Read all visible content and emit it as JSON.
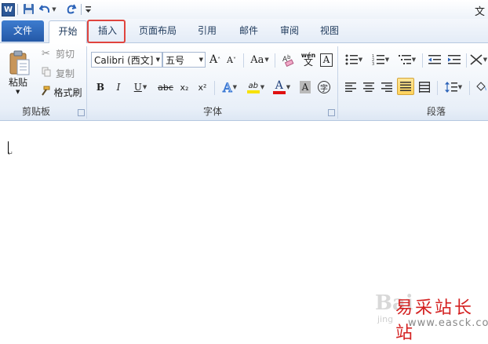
{
  "quick_access": {
    "app_logo": "W",
    "save_icon": "save-icon",
    "undo_icon": "undo-icon",
    "redo_icon": "redo-icon",
    "customize_icon": "customize-qat-icon"
  },
  "window": {
    "title_fragment": "文"
  },
  "tabs": [
    {
      "label": "文件"
    },
    {
      "label": "开始"
    },
    {
      "label": "插入"
    },
    {
      "label": "页面布局"
    },
    {
      "label": "引用"
    },
    {
      "label": "邮件"
    },
    {
      "label": "审阅"
    },
    {
      "label": "视图"
    }
  ],
  "clipboard": {
    "paste_label": "粘贴",
    "cut_label": "剪切",
    "copy_label": "复制",
    "format_painter_label": "格式刷",
    "group_label": "剪贴板"
  },
  "font": {
    "font_name": "Calibri (西文]",
    "font_size": "五号",
    "group_label": "字体",
    "bold": "B",
    "italic": "I",
    "underline": "U",
    "strike": "abc",
    "subscript": "x₂",
    "superscript": "x²",
    "text_effect": "A",
    "highlight": "ab",
    "font_color": "A",
    "char_shading": "A",
    "enclose": "字",
    "grow": "A",
    "shrink": "A",
    "change_case": "Aa",
    "phonetic_top": "wén",
    "phonetic_bottom": "文",
    "char_border": "A"
  },
  "paragraph": {
    "group_label": "段落"
  },
  "watermark": {
    "baidu": "Bai",
    "jing": "jing",
    "site_name": "易采站长站",
    "site_url": "www.easck.com"
  },
  "colors": {
    "accent": "#2b5797",
    "highlight_box": "#e0443e",
    "font_color_bar": "#e01010",
    "highlight_bar": "#f7e200"
  }
}
